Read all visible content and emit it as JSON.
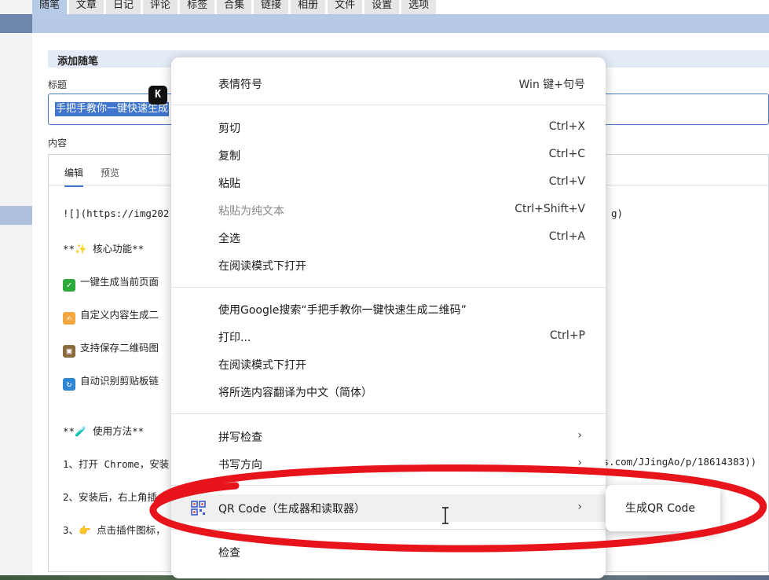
{
  "nav": {
    "tabs": [
      "随笔",
      "文章",
      "日记",
      "评论",
      "标签",
      "合集",
      "链接",
      "相册",
      "文件",
      "设置",
      "选项"
    ],
    "active_index": 0
  },
  "form": {
    "section_title": "添加随笔",
    "title_label": "标题",
    "title_value": "手把手教你一键快速生成",
    "content_label": "内容",
    "editor_tabs": [
      "编辑",
      "预览"
    ],
    "badge": "K"
  },
  "markdown": {
    "line1_left": "![](https://img202",
    "line1_right": "g)",
    "line2": "**✨ 核心功能**",
    "line3": "一键生成当前页面",
    "line4": "自定义内容生成二",
    "line5": "支持保存二维码图",
    "line6": "自动识别剪贴板链",
    "line7": "**🧪 使用方法**",
    "line8_left": "1、打开 Chrome，安装",
    "line8_right": "gs.com/JJingAo/p/18614383))",
    "line9": "2、安装后，右上角插",
    "line10": "3、👉 点击插件图标，"
  },
  "menu": {
    "emoji": {
      "label": "表情符号",
      "shortcut": "Win 键+句号"
    },
    "cut": {
      "label": "剪切",
      "shortcut": "Ctrl+X"
    },
    "copy": {
      "label": "复制",
      "shortcut": "Ctrl+C"
    },
    "paste": {
      "label": "粘贴",
      "shortcut": "Ctrl+V"
    },
    "paste_plain": {
      "label": "粘贴为纯文本",
      "shortcut": "Ctrl+Shift+V"
    },
    "select_all": {
      "label": "全选",
      "shortcut": "Ctrl+A"
    },
    "reader1": {
      "label": "在阅读模式下打开"
    },
    "google": {
      "label": "使用Google搜索“手把手教你一键快速生成二维码”"
    },
    "print": {
      "label": "打印...",
      "shortcut": "Ctrl+P"
    },
    "reader2": {
      "label": "在阅读模式下打开"
    },
    "translate": {
      "label": "将所选内容翻译为中文（简体）"
    },
    "spell": {
      "label": "拼写检查"
    },
    "direction": {
      "label": "书写方向"
    },
    "qr": {
      "label": "QR Code（生成器和读取器）"
    },
    "inspect": {
      "label": "检查"
    }
  },
  "submenu": {
    "generate": "生成QR Code"
  },
  "colors": {
    "accent": "#3f75cc",
    "annotation": "#e8141b"
  }
}
